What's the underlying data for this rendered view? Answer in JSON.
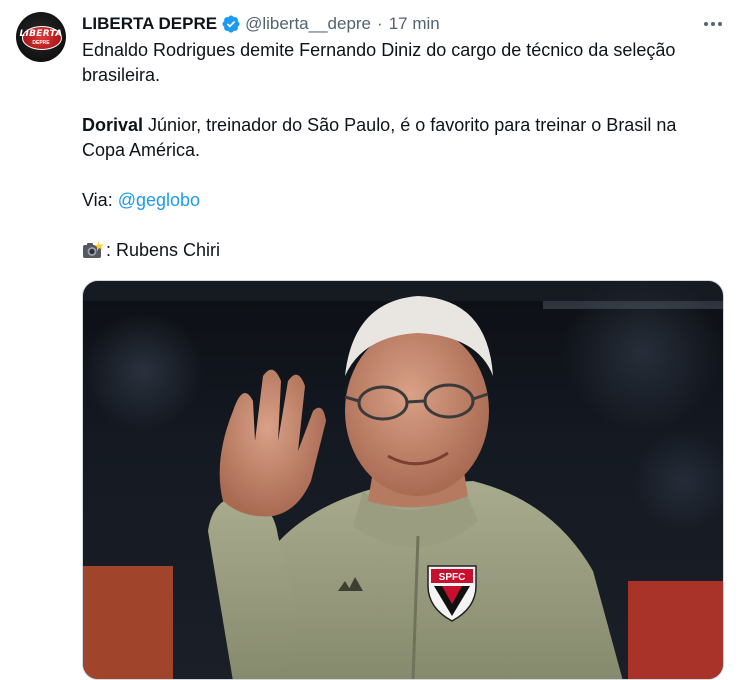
{
  "tweet": {
    "author_name": "LIBERTA DEPRE",
    "handle": "@liberta__depre",
    "separator": "·",
    "time": "17 min",
    "avatar": {
      "line1": "LIBERTA",
      "line2": "DEPRE"
    },
    "paragraph1": "Ednaldo Rodrigues demite Fernando Diniz do cargo de técnico da seleção brasileira.",
    "paragraph2_bold": "Dorival",
    "paragraph2_rest": " Júnior, treinador do São Paulo, é o favorito para treinar o Brasil na Copa América.",
    "via_label": "Via: ",
    "via_mention": "@geglobo",
    "credit": ": Rubens Chiri",
    "camera_icon": "camera-flash-emoji",
    "verified_color": "#1d9bf0",
    "photo": {
      "crest_text": "SPFC"
    }
  }
}
